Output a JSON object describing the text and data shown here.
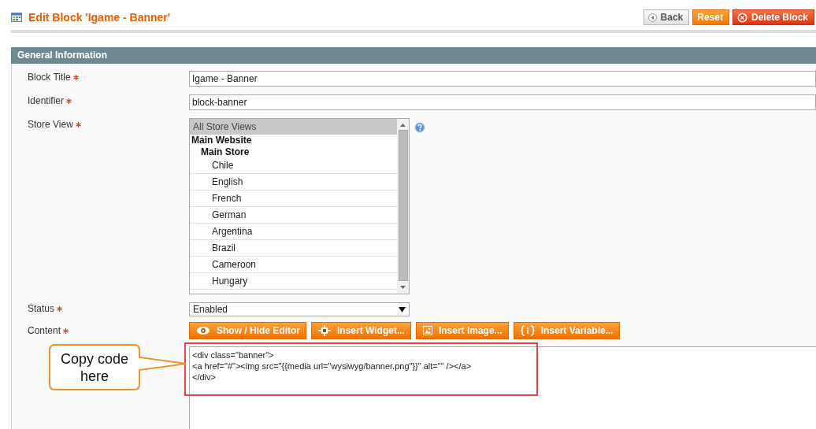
{
  "header": {
    "title": "Edit Block 'Igame - Banner'",
    "buttons": [
      {
        "label": "Back",
        "kind": "back"
      },
      {
        "label": "Reset",
        "kind": "reset"
      },
      {
        "label": "Delete Block",
        "kind": "delete"
      }
    ]
  },
  "section": {
    "title": "General Information"
  },
  "fields": [
    {
      "label": "Block Title",
      "required": true,
      "kind": "text",
      "value": "Igame - Banner"
    },
    {
      "label": "Identifier",
      "required": true,
      "kind": "text",
      "value": "block-banner"
    },
    {
      "label": "Store View",
      "required": true,
      "kind": "multiselect",
      "help": true,
      "options": [
        {
          "label": "All Store Views",
          "selected": true
        },
        {
          "label": "Main Website",
          "children": [
            {
              "label": "Main Store",
              "children": [
                {
                  "label": "Chile",
                  "selected": false
                },
                {
                  "label": "English",
                  "selected": false
                },
                {
                  "label": "French",
                  "selected": false
                },
                {
                  "label": "German",
                  "selected": false
                },
                {
                  "label": "Argentina",
                  "selected": false
                },
                {
                  "label": "Brazil",
                  "selected": false
                },
                {
                  "label": "Cameroon",
                  "selected": false
                },
                {
                  "label": "Hungary",
                  "selected": false
                }
              ]
            }
          ]
        }
      ]
    },
    {
      "label": "Status",
      "required": true,
      "kind": "select",
      "value": "Enabled"
    },
    {
      "label": "Content",
      "required": true,
      "kind": "editor",
      "buttons": [
        {
          "label": "Show / Hide Editor",
          "kind": "eye"
        },
        {
          "label": "Insert Widget...",
          "kind": "widget"
        },
        {
          "label": "Insert Image...",
          "kind": "image"
        },
        {
          "label": "Insert Variable...",
          "kind": "variable"
        }
      ],
      "value": "<div class=\"banner\">\n<a href=\"#\"><img src=\"{{media url=\"wysiwyg/banner.png\"}}\" alt=\"\" /></a>\n</div>"
    }
  ],
  "annotation": {
    "text": "Copy code here"
  }
}
